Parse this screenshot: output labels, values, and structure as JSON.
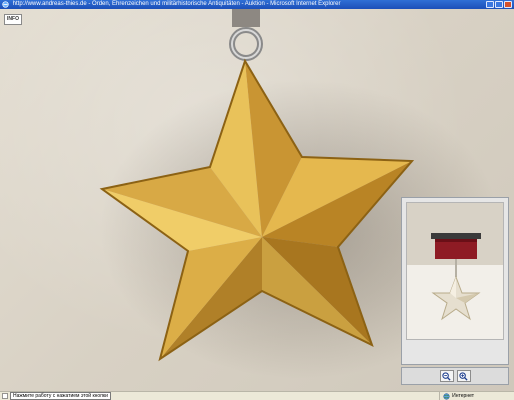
{
  "window": {
    "title": "http://www.andreas-thies.de - Orden, Ehrenzeichen und militärhistorische Antiquitäten - Auktion - Microsoft Internet Explorer"
  },
  "viewer": {
    "info_label": "INFO",
    "image": "gold-star-medal-photo",
    "thumbnail": "gold-star-medal-with-ribbon"
  },
  "zoom": {
    "zoom_out_icon": "zoom-out-icon",
    "zoom_in_icon": "zoom-in-icon"
  },
  "status": {
    "message": "Нажмите работу с нажатием этой кнопки",
    "zone": "Интернет"
  },
  "colors": {
    "titlebar": "#1c4fb8",
    "gold": "#d4a43c",
    "ribbon": "#8e1b24",
    "background": "#d6d0c3"
  }
}
